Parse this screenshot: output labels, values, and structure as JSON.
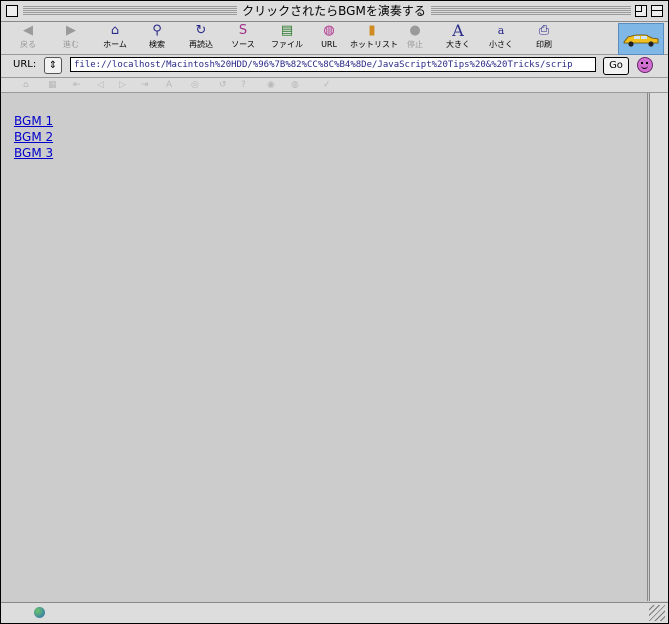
{
  "window": {
    "title": "クリックされたらBGMを演奏する"
  },
  "toolbar": {
    "buttons": [
      {
        "label": "戻る",
        "icon": "back-arrow-icon",
        "enabled": false
      },
      {
        "label": "進む",
        "icon": "forward-arrow-icon",
        "enabled": false
      },
      {
        "label": "ホーム",
        "icon": "home-icon",
        "enabled": true
      },
      {
        "label": "検索",
        "icon": "search-icon",
        "enabled": true
      },
      {
        "label": "再読込",
        "icon": "reload-icon",
        "enabled": true
      },
      {
        "label": "ソース",
        "icon": "source-icon",
        "enabled": true
      },
      {
        "label": "ファイル",
        "icon": "file-icon",
        "enabled": true
      },
      {
        "label": "URL",
        "icon": "url-icon",
        "enabled": true
      },
      {
        "label": "ホットリスト",
        "icon": "hotlist-icon",
        "enabled": true
      },
      {
        "label": "停止",
        "icon": "stop-icon",
        "enabled": false
      },
      {
        "label": "大きく",
        "icon": "larger-text-icon",
        "enabled": true
      },
      {
        "label": "小さく",
        "icon": "smaller-text-icon",
        "enabled": true
      },
      {
        "label": "印刷",
        "icon": "print-icon",
        "enabled": true
      }
    ]
  },
  "urlbar": {
    "label": "URL:",
    "popup_glyph": "⇕",
    "value": "file://localhost/Macintosh%20HDD/%96%7B%82%CC%8C%B4%8De/JavaScript%20Tips%20&%20Tricks/scrip",
    "go_label": "Go"
  },
  "favorites": {
    "glyphs": [
      "⌂",
      "▦",
      "⇤",
      "◁",
      "▷",
      "⇥",
      "A",
      "◎",
      "↺",
      "?",
      "◉",
      "◍",
      "✓"
    ]
  },
  "content": {
    "links": [
      "BGM 1",
      "BGM 2",
      "BGM 3"
    ]
  },
  "colors": {
    "chrome": "#dddddd",
    "content_bg": "#cccccc",
    "link": "#0000cc",
    "brand": "#7fb8e6"
  }
}
